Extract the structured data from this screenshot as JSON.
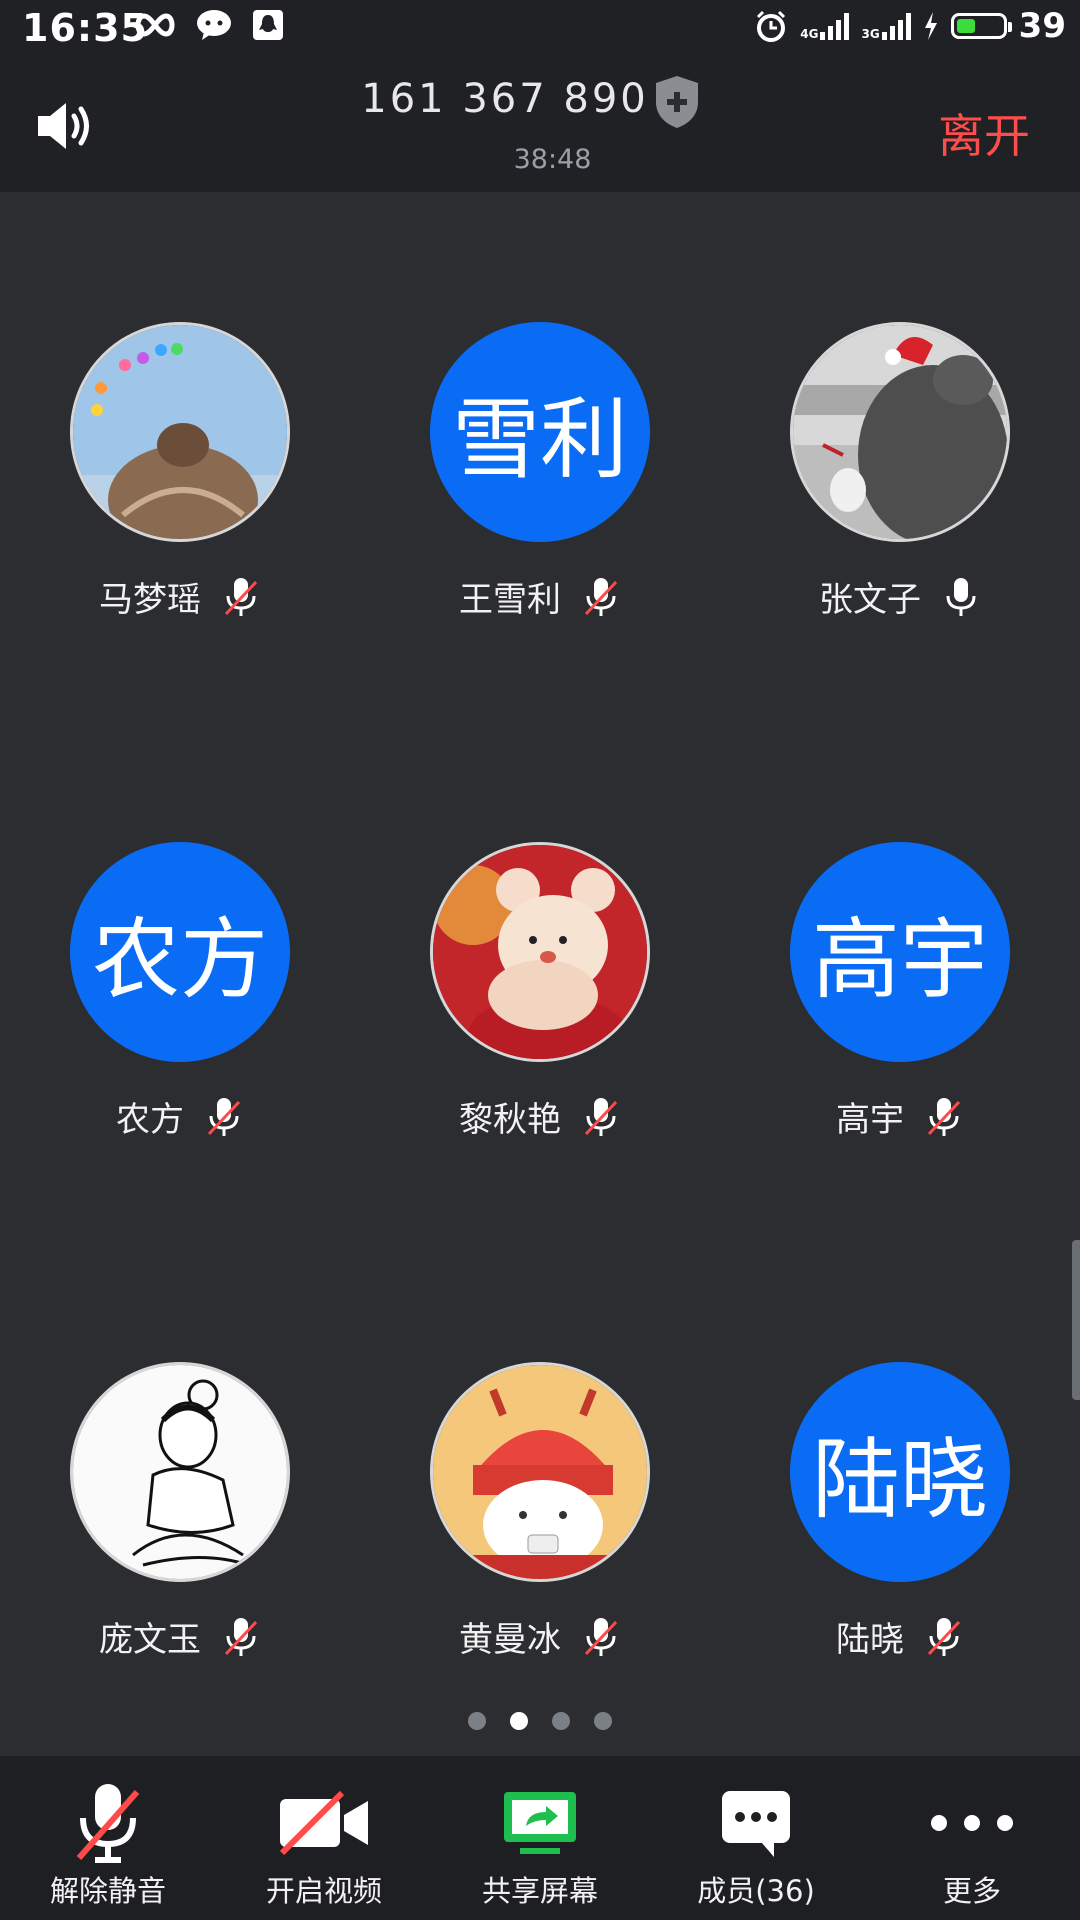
{
  "status_bar": {
    "time": "16:35",
    "network_1": "4G",
    "network_2": "3G",
    "battery": "39"
  },
  "header": {
    "meeting_id": "161 367 890",
    "duration": "38:48",
    "leave_label": "离开"
  },
  "participants": [
    {
      "name": "马梦瑶",
      "avatar_text": "",
      "avatar_type": "photo",
      "muted": true
    },
    {
      "name": "王雪利",
      "avatar_text": "雪利",
      "avatar_type": "text",
      "muted": true
    },
    {
      "name": "张文子",
      "avatar_text": "",
      "avatar_type": "photo",
      "muted": false
    },
    {
      "name": "农方",
      "avatar_text": "农方",
      "avatar_type": "text",
      "muted": true
    },
    {
      "name": "黎秋艳",
      "avatar_text": "",
      "avatar_type": "photo",
      "muted": true
    },
    {
      "name": "高宇",
      "avatar_text": "高宇",
      "avatar_type": "text",
      "muted": true
    },
    {
      "name": "庞文玉",
      "avatar_text": "",
      "avatar_type": "photo",
      "muted": true
    },
    {
      "name": "黄曼冰",
      "avatar_text": "",
      "avatar_type": "photo",
      "muted": true
    },
    {
      "name": "陆晓",
      "avatar_text": "陆晓",
      "avatar_type": "text",
      "muted": true
    }
  ],
  "pagination": {
    "pages": 4,
    "current": 2
  },
  "toolbar": {
    "unmute": "解除静音",
    "start_video": "开启视频",
    "share_screen": "共享屏幕",
    "members": "成员(36)",
    "more": "更多"
  },
  "colors": {
    "accent_blue": "#0a6cf5",
    "leave_red": "#ff4d4d",
    "share_green": "#1fbf4f"
  }
}
